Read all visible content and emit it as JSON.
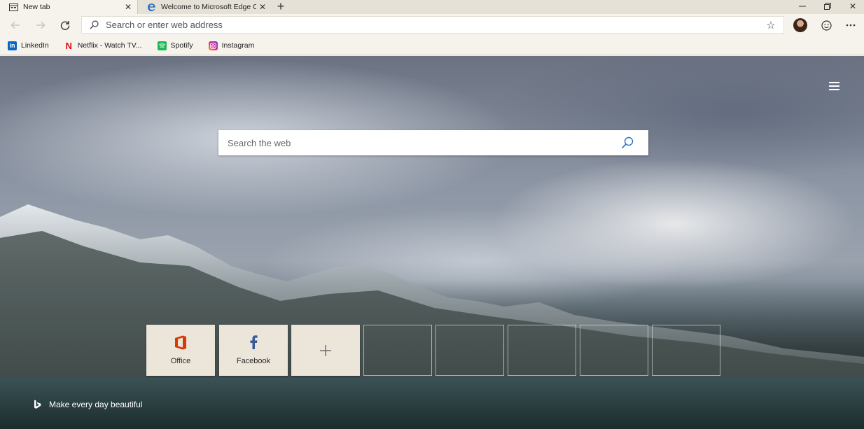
{
  "tabs": [
    {
      "title": "New tab",
      "icon": "newtab-page-icon",
      "active": true
    },
    {
      "title": "Welcome to Microsoft Edge Can",
      "icon": "edge-logo-icon",
      "active": false
    }
  ],
  "window_controls": [
    "minimize-icon",
    "restore-icon",
    "close-icon"
  ],
  "toolbar": {
    "address_placeholder": "Search or enter web address",
    "icons": [
      "back-arrow-icon",
      "forward-arrow-icon",
      "refresh-icon",
      "search-icon",
      "star-icon",
      "profile-avatar",
      "feedback-smiley-icon",
      "more-options-icon"
    ]
  },
  "favorites": [
    {
      "label": "LinkedIn",
      "icon": "linkedin-icon",
      "color": "#0a66c2"
    },
    {
      "label": "Netflix - Watch TV...",
      "icon": "netflix-icon",
      "color": "#e50914"
    },
    {
      "label": "Spotify",
      "icon": "spotify-icon",
      "color": "#1db954"
    },
    {
      "label": "Instagram",
      "icon": "instagram-icon",
      "color": "#d6249f"
    }
  ],
  "ntp": {
    "search_placeholder": "Search the web",
    "tiles": [
      {
        "label": "Office",
        "icon": "office-icon",
        "color": "#d83b01"
      },
      {
        "label": "Facebook",
        "icon": "facebook-icon",
        "color": "#3b5998"
      },
      {
        "label": "",
        "icon": "add-icon"
      }
    ],
    "empty_tile_count": 5,
    "bing_tagline": "Make every day beautiful"
  }
}
